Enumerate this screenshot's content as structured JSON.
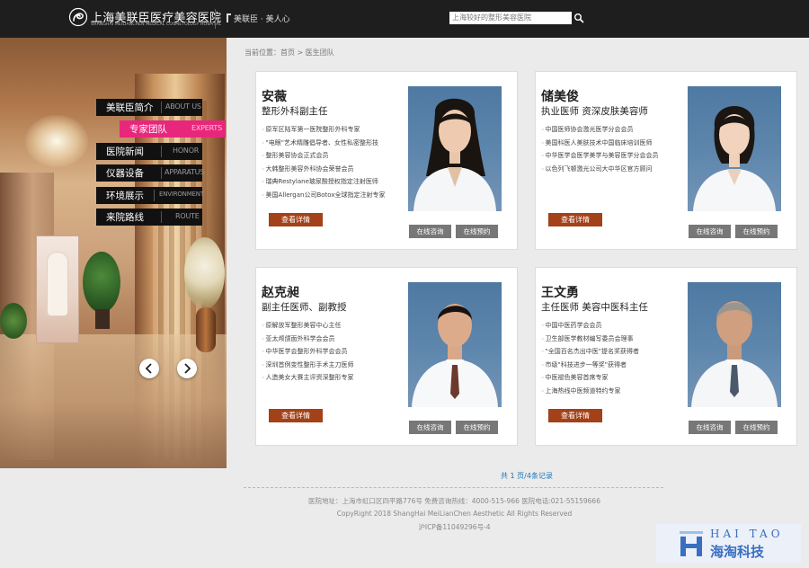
{
  "header": {
    "logo_cn": "上海美联臣医疗美容医院",
    "logo_en": "SHANGHAI MEILIANCHEN MEDICAL COSMETOLOGY HOSPITAL",
    "slogan": "美联臣 · 美人心",
    "search_placeholder": "上海较好的整形美容医院",
    "logo_icon": "swirl-logo-icon",
    "search_icon": "search-icon"
  },
  "menu": [
    {
      "cn": "美联臣简介",
      "en": "ABOUT US",
      "active": false
    },
    {
      "cn": "专家团队",
      "en": "EXPERTS",
      "active": true
    },
    {
      "cn": "医院新闻",
      "en": "HONOR",
      "active": false
    },
    {
      "cn": "仪器设备",
      "en": "APPARATUS",
      "active": false
    },
    {
      "cn": "环境展示",
      "en": "ENVIRONMENT",
      "active": false
    },
    {
      "cn": "来院路线",
      "en": "ROUTE",
      "active": false
    }
  ],
  "breadcrumb": "当前位置：首页 > 医生团队",
  "doctors": [
    {
      "name": "安薇",
      "title": "整形外科副主任",
      "items": [
        "原军区陆军第一医院整形外科专家",
        "\"电眼\"艺术精雕倡导者、女性私密整形技",
        "整形美容协会正式会员",
        "大韩整形美容外科协会荣誉会员",
        "瑞典Restylane玻尿酸授权指定注射医师",
        "美国Allergan公司Botox全球指定注射专家"
      ]
    },
    {
      "name": "储美俊",
      "title": "执业医师 资深皮肤美容师",
      "items": [
        "中国医师协会激光医学分会会员",
        "美国科医人美肤技术中国临床培训医师",
        "中华医学会医学美学与美容医学分会会员",
        "以色列飞顿激光公司大中华区官方顾问"
      ]
    },
    {
      "name": "赵克昶",
      "title": "副主任医师、副教授",
      "items": [
        "原解放军整形美容中心主任",
        "亚太颅颌面外科学会会员",
        "中华医学会整形外科学会会员",
        "深圳首例变性整形手术主刀医师",
        "人造美女大赛主评资深整形专家"
      ]
    },
    {
      "name": "王文勇",
      "title": "主任医师 美容中医科主任",
      "items": [
        "中国中医药学会会员",
        "卫生部医学教材编写委员会理事",
        "\"全国百名杰出中医\"提名奖获得者",
        "市级\"科技进步一等奖\"获得者",
        "中医褪色美容首席专家",
        "上海热线中医频道特约专家"
      ]
    }
  ],
  "buttons": {
    "detail": "查看详情",
    "consult": "在线咨询",
    "appoint": "在线预约"
  },
  "pagination": "共 1 页/4条记录",
  "footer": {
    "address": "医院地址：上海市虹口区四平路776号 免费咨询热线：4000-515-966 医院电话:021-55159666",
    "copyright": "CopyRight 2018 ShangHai MeiLianChen Aesthetic All Rights Reserved",
    "icp": "沪ICP备11049296号-4"
  },
  "watermark": {
    "en": "HAI TAO",
    "cn": "海淘科技"
  },
  "colors": {
    "header_bg": "#1e1e1e",
    "menu_active": "#e8277c",
    "detail_button": "#a34118",
    "link_blue": "#1d76b5",
    "photo_bg": "#5a81a9"
  }
}
